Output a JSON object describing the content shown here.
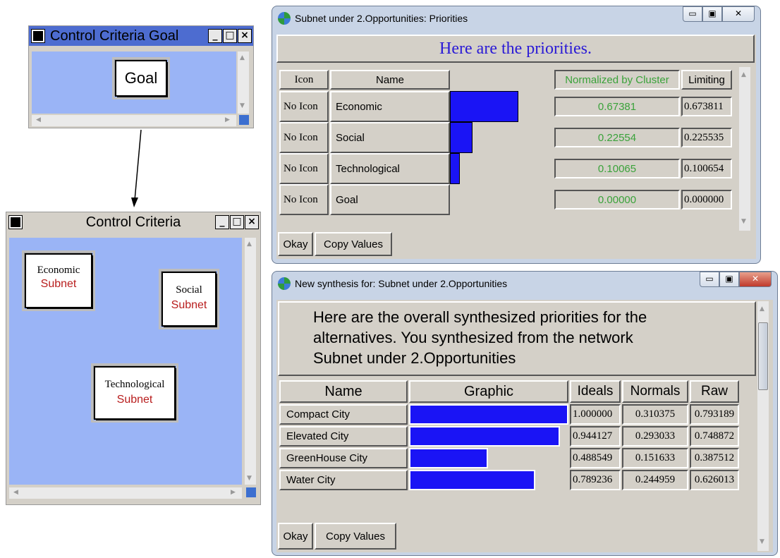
{
  "goal_window": {
    "title": "Control Criteria Goal",
    "node": {
      "label": "Goal"
    }
  },
  "control_window": {
    "title": "Control Criteria",
    "nodes": [
      {
        "name": "Economic",
        "sub": "Subnet"
      },
      {
        "name": "Social",
        "sub": "Subnet"
      },
      {
        "name": "Technological",
        "sub": "Subnet"
      }
    ]
  },
  "priorities_window": {
    "title": "Subnet under 2.Opportunities: Priorities",
    "heading": "Here are the priorities.",
    "headers": {
      "icon": "Icon",
      "name": "Name",
      "normalized": "Normalized by Cluster",
      "limiting": "Limiting"
    },
    "rows": [
      {
        "icon": "No Icon",
        "name": "Economic",
        "normalized": "0.67381",
        "limiting": "0.673811",
        "value": 0.67381
      },
      {
        "icon": "No Icon",
        "name": "Social",
        "normalized": "0.22554",
        "limiting": "0.225535",
        "value": 0.22554
      },
      {
        "icon": "No Icon",
        "name": "Technological",
        "normalized": "0.10065",
        "limiting": "0.100654",
        "value": 0.10065
      },
      {
        "icon": "No Icon",
        "name": "Goal",
        "normalized": "0.00000",
        "limiting": "0.000000",
        "value": 0.0
      }
    ],
    "buttons": {
      "okay": "Okay",
      "copy": "Copy Values"
    },
    "colors": {
      "bar": "#1a14f5",
      "normalized_text": "#3aa23a",
      "heading_text": "#2a1ad6"
    }
  },
  "synthesis_window": {
    "title": "New synthesis for: Subnet under 2.Opportunities",
    "heading_lines": [
      "Here are the overall synthesized priorities for the",
      "alternatives.  You synthesized from the network",
      "Subnet under 2.Opportunities"
    ],
    "headers": {
      "name": "Name",
      "graphic": "Graphic",
      "ideals": "Ideals",
      "normals": "Normals",
      "raw": "Raw"
    },
    "rows": [
      {
        "name": "Compact City",
        "ideals": "1.000000",
        "normals": "0.310375",
        "raw": "0.793189",
        "value": 1.0
      },
      {
        "name": "Elevated City",
        "ideals": "0.944127",
        "normals": "0.293033",
        "raw": "0.748872",
        "value": 0.944127
      },
      {
        "name": "GreenHouse City",
        "ideals": "0.488549",
        "normals": "0.151633",
        "raw": "0.387512",
        "value": 0.488549
      },
      {
        "name": "Water City",
        "ideals": "0.789236",
        "normals": "0.244959",
        "raw": "0.626013",
        "value": 0.789236
      }
    ],
    "buttons": {
      "okay": "Okay",
      "copy": "Copy Values"
    }
  }
}
